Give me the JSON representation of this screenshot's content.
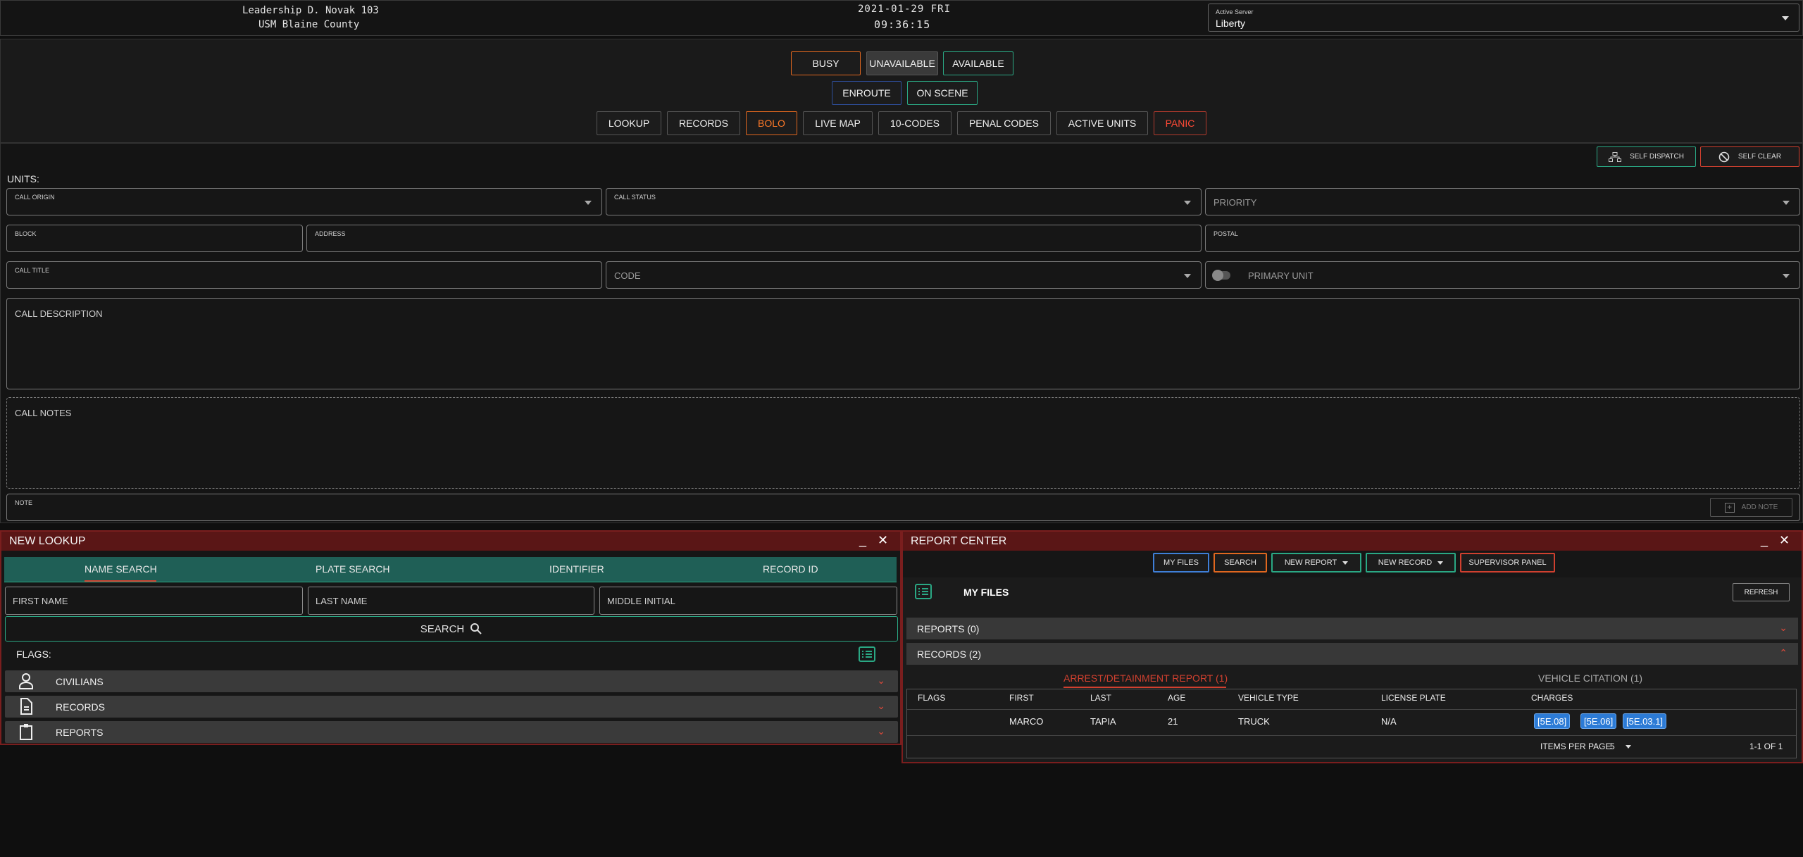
{
  "header": {
    "user_line1": "Leadership D. Novak 103",
    "user_line2": "USM Blaine County",
    "date": "2021-01-29 FRI",
    "time": "09:36:15",
    "server_label": "Active Server",
    "server_value": "Liberty"
  },
  "status_buttons": {
    "busy": "BUSY",
    "unavailable": "UNAVAILABLE",
    "available": "AVAILABLE",
    "enroute": "ENROUTE",
    "on_scene": "ON SCENE"
  },
  "nav_buttons": {
    "lookup": "LOOKUP",
    "records": "RECORDS",
    "bolo": "BOLO",
    "live_map": "LIVE MAP",
    "ten_codes": "10-CODES",
    "penal_codes": "PENAL CODES",
    "active_units": "ACTIVE UNITS",
    "panic": "PANIC"
  },
  "dispatch": {
    "self_dispatch": "SELF DISPATCH",
    "self_clear": "SELF CLEAR",
    "units_label": "UNITS:",
    "call_origin": "CALL ORIGIN",
    "call_status": "CALL STATUS",
    "priority": "PRIORITY",
    "block": "BLOCK",
    "address": "ADDRESS",
    "postal": "POSTAL",
    "call_title": "CALL TITLE",
    "code": "CODE",
    "primary_unit": "PRIMARY UNIT",
    "call_description": "CALL DESCRIPTION",
    "call_notes": "CALL NOTES",
    "note": "NOTE",
    "add_note": "ADD NOTE"
  },
  "lookup_panel": {
    "title": "NEW LOOKUP",
    "minimize": "_",
    "close": "✕",
    "tabs": [
      "NAME SEARCH",
      "PLATE SEARCH",
      "IDENTIFIER",
      "RECORD ID"
    ],
    "first_name": "FIRST NAME",
    "last_name": "LAST NAME",
    "middle_initial": "MIDDLE INITIAL",
    "search": "SEARCH",
    "flags_label": "FLAGS:",
    "sections": [
      "CIVILIANS",
      "RECORDS",
      "REPORTS"
    ]
  },
  "report_panel": {
    "title": "REPORT CENTER",
    "minimize": "_",
    "close": "✕",
    "buttons": {
      "my_files": "MY FILES",
      "search": "SEARCH",
      "new_report": "NEW REPORT",
      "new_record": "NEW RECORD",
      "supervisor_panel": "SUPERVISOR PANEL"
    },
    "my_files_heading": "MY FILES",
    "refresh": "REFRESH",
    "reports_section": "REPORTS (0)",
    "records_section": "RECORDS (2)",
    "subtabs": [
      "ARREST/DETAINMENT REPORT (1)",
      "VEHICLE CITATION (1)"
    ],
    "table": {
      "headers": [
        "FLAGS",
        "FIRST",
        "LAST",
        "AGE",
        "VEHICLE TYPE",
        "LICENSE PLATE",
        "CHARGES"
      ],
      "row": {
        "flags": "",
        "first": "MARCO",
        "last": "TAPIA",
        "age": "21",
        "vehicle_type": "TRUCK",
        "license_plate": "N/A",
        "charges": [
          "[5E.08]",
          "[5E.06]",
          "[5E.03.1]"
        ]
      }
    },
    "items_per_page_label": "ITEMS PER PAGE",
    "items_per_page_value": "5",
    "range": "1-1 OF 1"
  },
  "colors": {
    "accent_teal": "#2aa884",
    "accent_orange": "#e0671f",
    "accent_red": "#b23a2d",
    "panel_header": "#5a1616",
    "chip_blue": "#2c7bd6"
  }
}
